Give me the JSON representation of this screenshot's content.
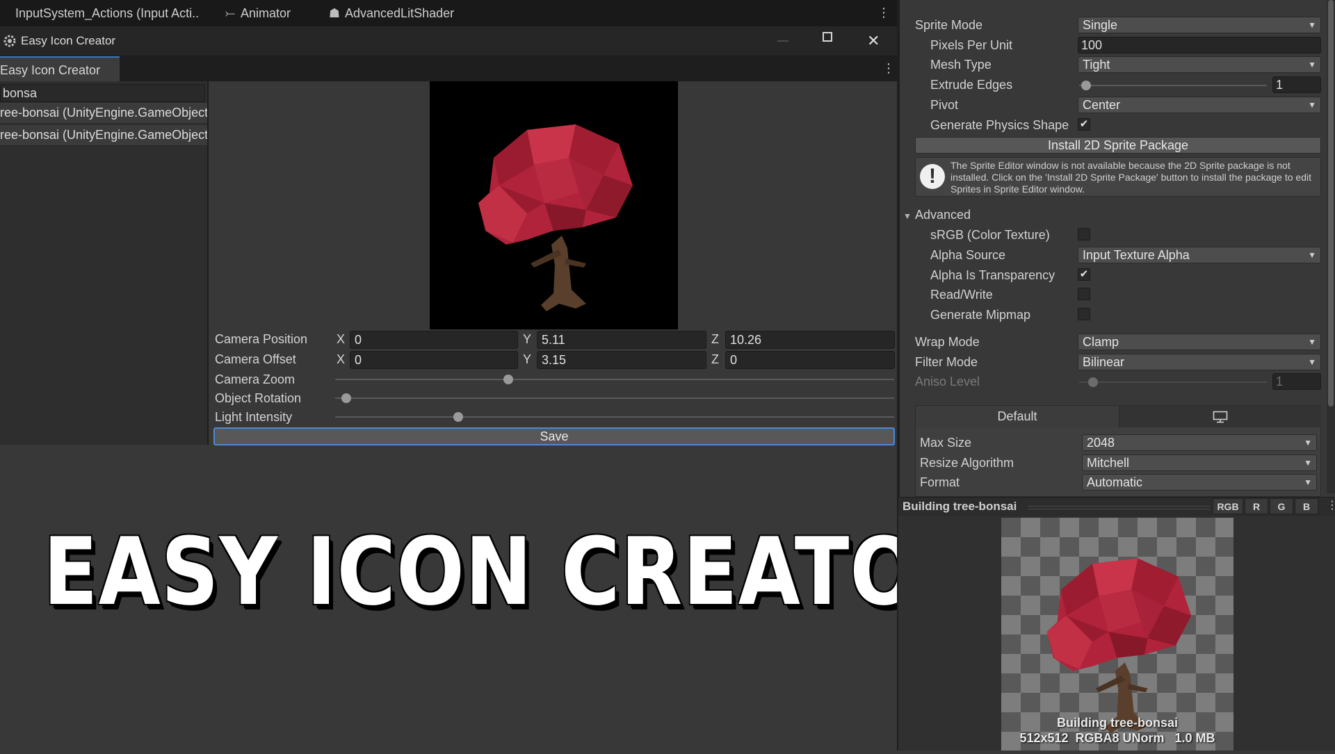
{
  "top_tabs": [
    {
      "label": "InputSystem_Actions (Input Acti..",
      "icon": "input-actions-icon"
    },
    {
      "label": "Animator",
      "icon": "animator-icon"
    },
    {
      "label": "AdvancedLitShader",
      "icon": "shader-icon"
    }
  ],
  "window": {
    "title": "Easy Icon Creator",
    "tab_label": "Easy Icon Creator",
    "minimize_glyph": "—",
    "maximize_glyph": "☐",
    "close_glyph": "✕",
    "more_glyph": "⋮"
  },
  "search": {
    "value": "bonsa"
  },
  "results": [
    {
      "label": "ree-bonsai (UnityEngine.GameObject)"
    },
    {
      "label": "ree-bonsai (UnityEngine.GameObject)"
    }
  ],
  "camera_position": {
    "label": "Camera Position",
    "x_label": "X",
    "y_label": "Y",
    "z_label": "Z",
    "x": "0",
    "y": "5.11",
    "z": "10.26"
  },
  "camera_offset": {
    "label": "Camera Offset",
    "x_label": "X",
    "y_label": "Y",
    "z_label": "Z",
    "x": "0",
    "y": "3.15",
    "z": "0"
  },
  "sliders": [
    {
      "label": "Camera Zoom",
      "fraction": 0.31
    },
    {
      "label": "Object Rotation",
      "fraction": 0.02
    },
    {
      "label": "Light Intensity",
      "fraction": 0.22
    }
  ],
  "save_label": "Save",
  "big_title": "EASY  ICON  CREATOR",
  "inspector": {
    "sprite_mode": {
      "label": "Sprite Mode",
      "value": "Single"
    },
    "pixels_per_unit": {
      "label": "Pixels Per Unit",
      "value": "100"
    },
    "mesh_type": {
      "label": "Mesh Type",
      "value": "Tight"
    },
    "extrude_edges": {
      "label": "Extrude Edges",
      "value": "1",
      "fraction": 0.0
    },
    "pivot": {
      "label": "Pivot",
      "value": "Center"
    },
    "generate_physics_shape": {
      "label": "Generate Physics Shape",
      "checked": true
    },
    "install_button": "Install 2D Sprite Package",
    "help_text": "The Sprite Editor window is not available because the 2D Sprite package is not installed. Click on the 'Install 2D Sprite Package' button to install the package to edit Sprites in Sprite Editor window.",
    "advanced_label": "Advanced",
    "srgb": {
      "label": "sRGB (Color Texture)",
      "checked": false
    },
    "alpha_source": {
      "label": "Alpha Source",
      "value": "Input Texture Alpha"
    },
    "alpha_is_transparency": {
      "label": "Alpha Is Transparency",
      "checked": true
    },
    "read_write": {
      "label": "Read/Write",
      "checked": false
    },
    "generate_mipmap": {
      "label": "Generate Mipmap",
      "checked": false
    },
    "wrap_mode": {
      "label": "Wrap Mode",
      "value": "Clamp"
    },
    "filter_mode": {
      "label": "Filter Mode",
      "value": "Bilinear"
    },
    "aniso_level": {
      "label": "Aniso Level",
      "value": "1"
    },
    "platform_tabs": [
      {
        "label": "Default"
      },
      {
        "label": "monitor",
        "icon": "monitor-icon"
      }
    ],
    "max_size": {
      "label": "Max Size",
      "value": "2048"
    },
    "resize_algorithm": {
      "label": "Resize Algorithm",
      "value": "Mitchell"
    },
    "format": {
      "label": "Format",
      "value": "Automatic"
    }
  },
  "preview": {
    "title": "Building tree-bonsai",
    "channels": [
      "RGB",
      "R",
      "G",
      "B"
    ],
    "caption_name": "Building tree-bonsai",
    "caption_info": "512x512  RGBA8 UNorm   1.0 MB"
  },
  "colors": {
    "accent": "#4a8ad4",
    "tree_foliage": "#b0233a",
    "tree_trunk": "#5a3f2c",
    "preview_bg": "#000000"
  }
}
